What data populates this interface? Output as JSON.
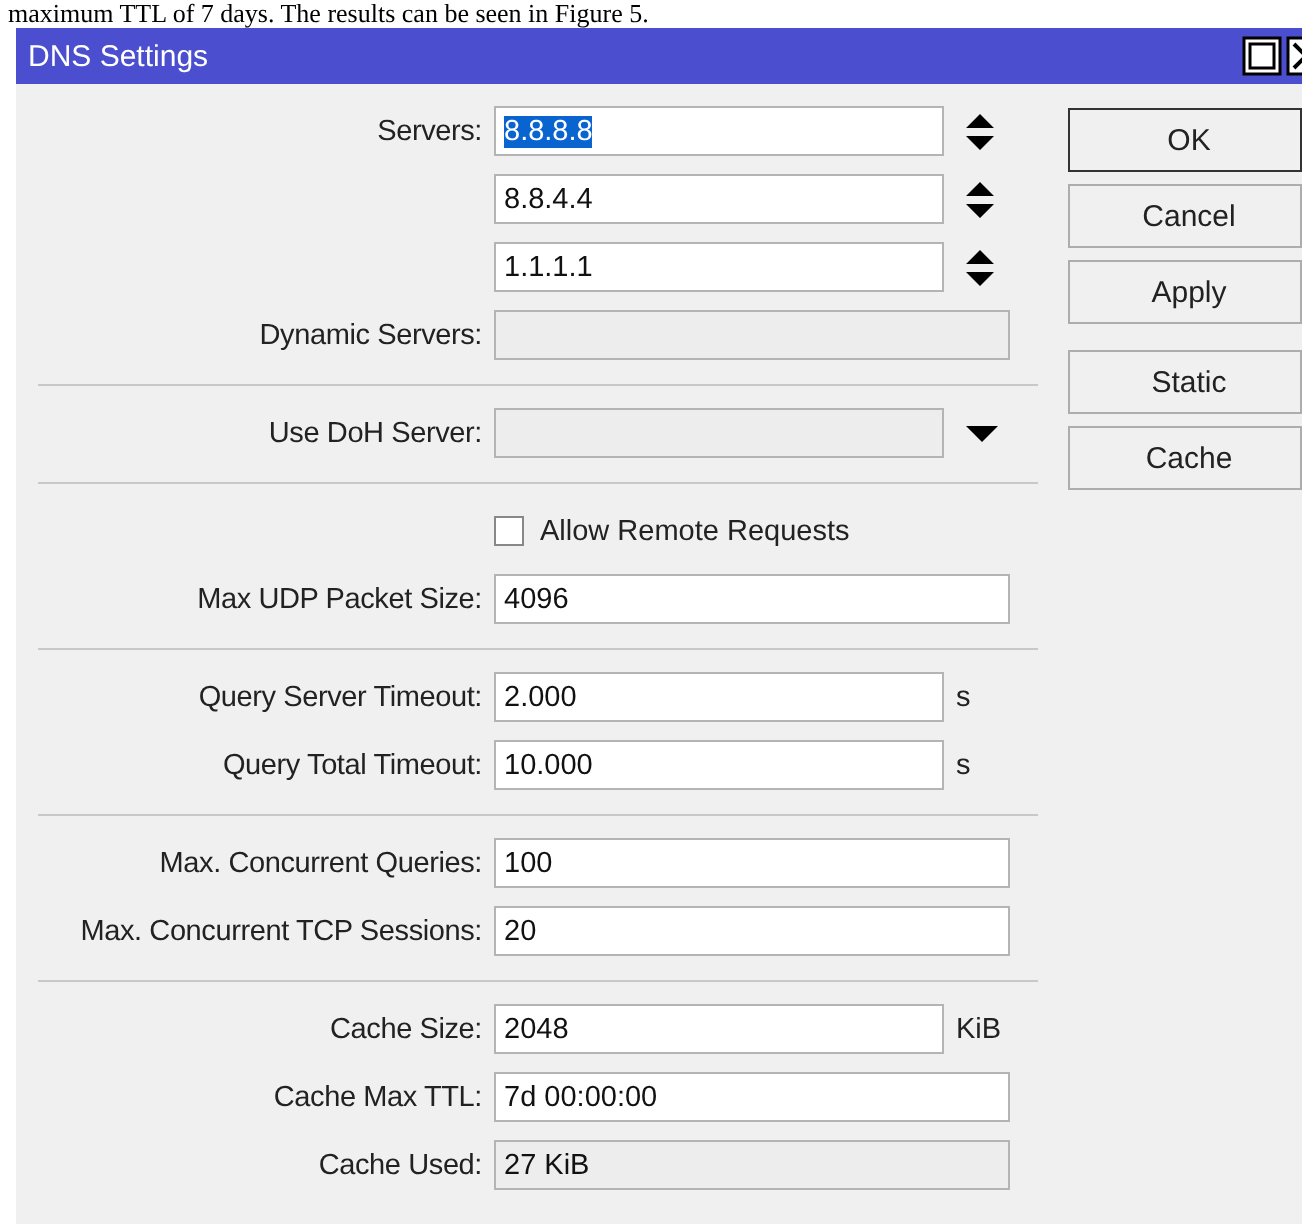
{
  "document_line": "maximum TTL of 7 days. The results can be seen in Figure 5.",
  "window": {
    "title": "DNS Settings"
  },
  "groups": [
    {
      "rows": [
        {
          "kind": "spin",
          "label": "Servers:",
          "value": "8.8.8.8",
          "selected": true
        },
        {
          "kind": "spin",
          "value": "8.8.4.4",
          "selected": false
        },
        {
          "kind": "spin",
          "value": "1.1.1.1",
          "selected": false
        },
        {
          "kind": "readonly",
          "label": "Dynamic Servers:"
        }
      ]
    },
    {
      "rows": [
        {
          "kind": "dropdown",
          "label": "Use DoH Server:"
        }
      ]
    },
    {
      "rows": [
        {
          "kind": "checkbox",
          "label": "Allow Remote Requests",
          "checked": false
        },
        {
          "kind": "input",
          "label": "Max UDP Packet Size:",
          "value": "4096"
        }
      ]
    },
    {
      "rows": [
        {
          "kind": "unit",
          "label": "Query Server Timeout:",
          "value": "2.000",
          "unit": "s"
        },
        {
          "kind": "unit",
          "label": "Query Total Timeout:",
          "value": "10.000",
          "unit": "s"
        }
      ]
    },
    {
      "rows": [
        {
          "kind": "input",
          "label": "Max. Concurrent Queries:",
          "value": "100"
        },
        {
          "kind": "input",
          "label": "Max. Concurrent TCP Sessions:",
          "value": "20"
        }
      ]
    },
    {
      "rows": [
        {
          "kind": "unit",
          "label": "Cache Size:",
          "value": "2048",
          "unit": "KiB"
        },
        {
          "kind": "input",
          "label": "Cache Max TTL:",
          "value": "7d 00:00:00"
        },
        {
          "kind": "readonly",
          "label": "Cache Used:",
          "value": "27 KiB"
        }
      ]
    }
  ],
  "button_groups": [
    [
      {
        "label": "OK",
        "focused": true
      },
      {
        "label": "Cancel",
        "focused": false
      },
      {
        "label": "Apply",
        "focused": false
      }
    ],
    [
      {
        "label": "Static",
        "focused": false
      },
      {
        "label": "Cache",
        "focused": false
      }
    ]
  ]
}
